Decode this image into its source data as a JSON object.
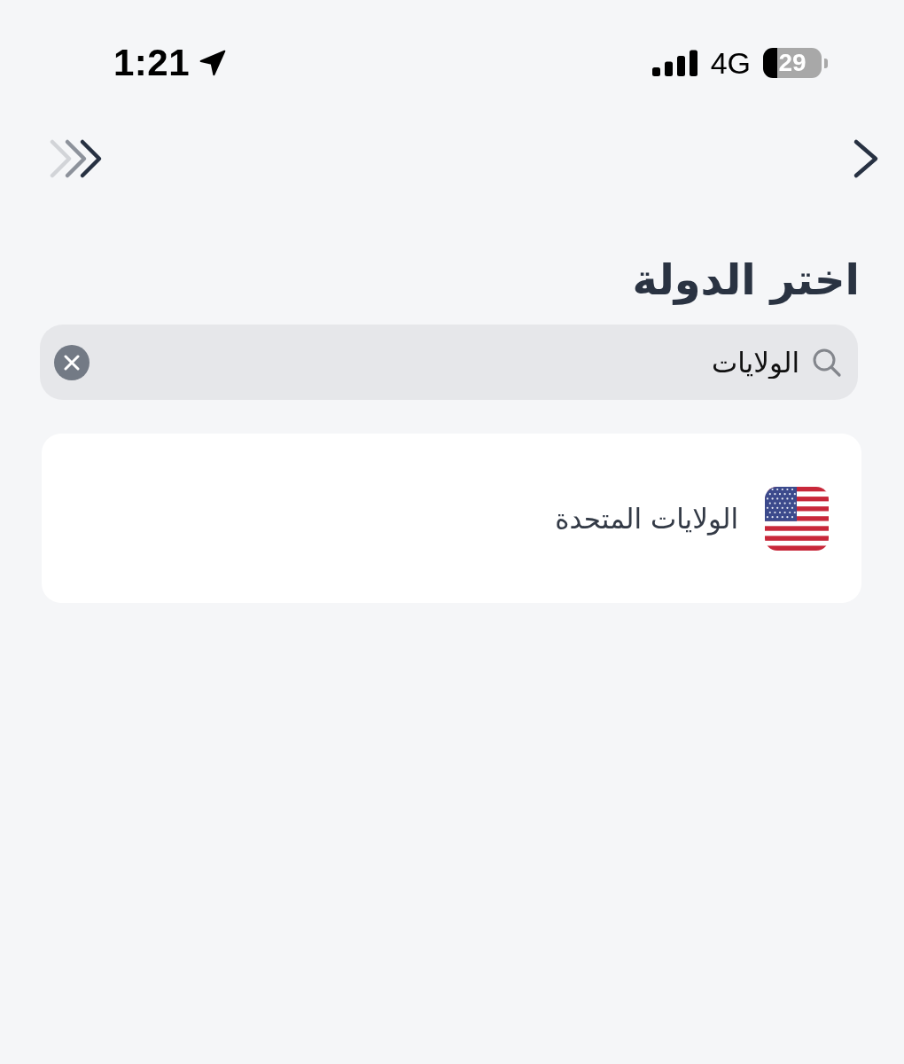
{
  "status_bar": {
    "time": "1:21",
    "network": "4G",
    "battery": "29"
  },
  "title": "اختر الدولة",
  "search": {
    "value": "الولايات"
  },
  "results": [
    {
      "name": "الولايات المتحدة"
    }
  ]
}
